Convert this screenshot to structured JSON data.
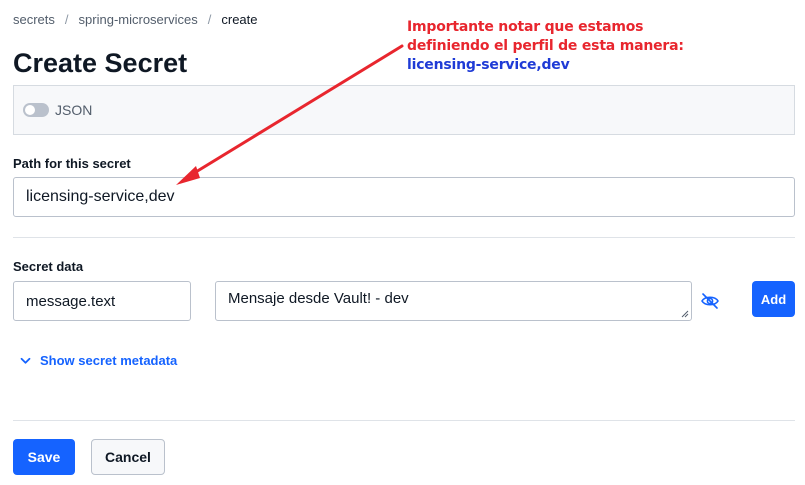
{
  "breadcrumb": {
    "items": [
      "secrets",
      "spring-microservices",
      "create"
    ],
    "separator": "/"
  },
  "title": "Create Secret",
  "json_toggle": {
    "label": "JSON",
    "enabled": false
  },
  "path": {
    "label": "Path for this secret",
    "value": "licensing-service,dev"
  },
  "secret_data": {
    "label": "Secret data",
    "key_value": "message.text",
    "value_value": "Mensaje desde Vault! - dev",
    "visibility_icon": "eye-slash-icon",
    "add_label": "Add"
  },
  "metadata": {
    "toggle_label": "Show secret metadata",
    "icon": "chevron-down-icon"
  },
  "actions": {
    "save_label": "Save",
    "cancel_label": "Cancel"
  },
  "annotation": {
    "line1": "Importante notar que estamos",
    "line2": "definiendo el perfil de esta manera:",
    "line3": "licensing-service,dev",
    "color_red": "#e8262e",
    "color_blue": "#1f3bd6"
  },
  "colors": {
    "accent": "#1563ff",
    "text": "#0f1824",
    "border": "#bac1cc"
  }
}
